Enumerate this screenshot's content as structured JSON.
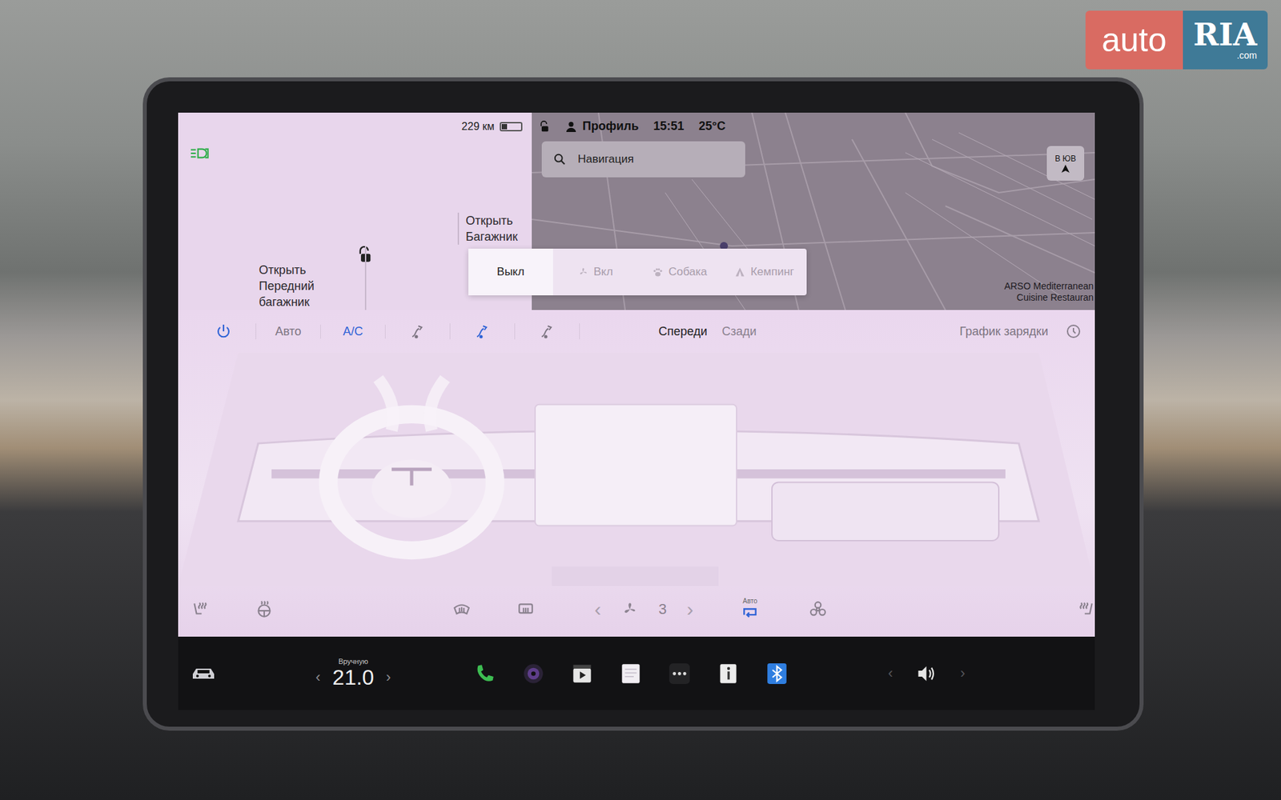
{
  "watermark": {
    "brand": "auto",
    "mark": "RIA",
    "domain": ".com"
  },
  "status": {
    "range": "229 км",
    "battery_level": 0.3,
    "profile": "Профиль",
    "time": "15:51",
    "temperature": "25°C"
  },
  "car": {
    "headlights_on": true,
    "unlocked": true,
    "frunk_lines": [
      "Открыть",
      "Передний",
      "багажник"
    ],
    "trunk_lines": [
      "Открыть",
      "Багажник"
    ]
  },
  "map": {
    "search_placeholder": "Навигация",
    "compass": "В ЮВ",
    "poi_lines": [
      "ARSO Mediterranean",
      "Cuisine Restauran"
    ]
  },
  "cabin_mode": {
    "options": [
      {
        "label": "Выкл",
        "kind": "off",
        "selected": true
      },
      {
        "label": "Вкл",
        "kind": "fan",
        "selected": false
      },
      {
        "label": "Собака",
        "kind": "dog",
        "selected": false
      },
      {
        "label": "Кемпинг",
        "kind": "camp",
        "selected": false
      }
    ]
  },
  "climate": {
    "toolbar": [
      {
        "kind": "power",
        "label": "",
        "selected": true
      },
      {
        "kind": "text",
        "label": "Авто",
        "selected": false
      },
      {
        "kind": "text",
        "label": "A/C",
        "selected": true
      },
      {
        "kind": "airflow",
        "label": "",
        "selected": false
      },
      {
        "kind": "airflow",
        "label": "",
        "selected": true
      },
      {
        "kind": "airflow",
        "label": "",
        "selected": false
      }
    ],
    "zones": [
      {
        "label": "Спереди",
        "selected": true
      },
      {
        "label": "Сзади",
        "selected": false
      }
    ],
    "schedule": "График зарядки",
    "controls_left": [
      {
        "kind": "seat",
        "on": false
      },
      {
        "kind": "wheel",
        "on": false
      },
      {
        "kind": "defrost-front",
        "on": false
      },
      {
        "kind": "defrost-rear",
        "on": false
      }
    ],
    "fan": {
      "prev": "‹",
      "speed": "3",
      "next": "›"
    },
    "recirc": {
      "label": "Авто",
      "on": true
    },
    "controls_right": [
      {
        "kind": "bio",
        "on": false
      },
      {
        "kind": "seat",
        "on": false
      }
    ]
  },
  "dock": {
    "temp_mode": "Вручную",
    "temp_prev": "‹",
    "temperature": "21.0",
    "temp_next": "›",
    "apps": [
      {
        "kind": "phone"
      },
      {
        "kind": "camera"
      },
      {
        "kind": "video"
      },
      {
        "kind": "notes"
      },
      {
        "kind": "more"
      },
      {
        "kind": "info"
      },
      {
        "kind": "bluetooth"
      }
    ],
    "volume_prev": "‹",
    "volume_next": "›"
  }
}
